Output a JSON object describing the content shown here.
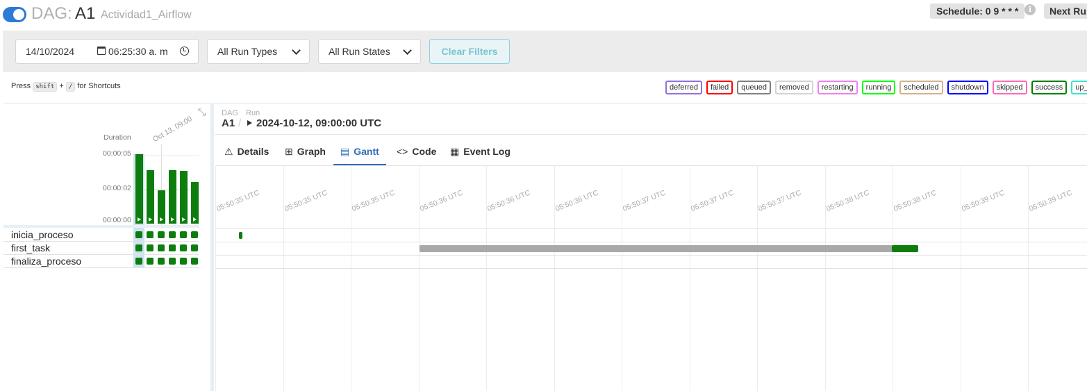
{
  "header": {
    "dag_prefix": "DAG:",
    "dag_id": "A1",
    "description": "Actividad1_Airflow",
    "schedule": "Schedule: 0 9 * * *",
    "info_icon_glyph": "i",
    "next_run": "Next Ru",
    "toggle_on": true
  },
  "filters": {
    "date": "14/10/2024",
    "time": "06:25:30 a. m",
    "run_types": "All Run Types",
    "run_states": "All Run States",
    "clear_label": "Clear Filters"
  },
  "shortcuts": {
    "press": "Press",
    "key1": "shift",
    "plus": "+",
    "key2": "/",
    "suffix": "for Shortcuts"
  },
  "legend": [
    {
      "label": "deferred",
      "color": "#9370db"
    },
    {
      "label": "failed",
      "color": "#ff0000"
    },
    {
      "label": "queued",
      "color": "#808080"
    },
    {
      "label": "removed",
      "color": "#d3d3d3"
    },
    {
      "label": "restarting",
      "color": "#ee82ee"
    },
    {
      "label": "running",
      "color": "#00ff00"
    },
    {
      "label": "scheduled",
      "color": "#d2b48c"
    },
    {
      "label": "shutdown",
      "color": "#0000ff"
    },
    {
      "label": "skipped",
      "color": "#ff69b4"
    },
    {
      "label": "success",
      "color": "#008000"
    },
    {
      "label": "up_for_",
      "color": "#40e0d0"
    }
  ],
  "grid": {
    "duration_label": "Duration",
    "ticks": [
      "00:00:05",
      "00:00:02",
      "00:00:00"
    ],
    "run_date_label": "Oct 13, 09:00",
    "run_durations": [
      1.0,
      0.77,
      0.48,
      0.77,
      0.76,
      0.6
    ],
    "tasks": [
      "inicia_proceso",
      "first_task",
      "finaliza_proceso"
    ],
    "collapse_icon": "⤡"
  },
  "breadcrumb": {
    "dag_label": "DAG",
    "run_label": "Run",
    "dag": "A1",
    "sep": "/",
    "run": "2024-10-12, 09:00:00 UTC"
  },
  "tabs": [
    {
      "icon": "⚠",
      "label": "Details"
    },
    {
      "icon": "⊞",
      "label": "Graph"
    },
    {
      "icon": "▤",
      "label": "Gantt"
    },
    {
      "icon": "<>",
      "label": "Code"
    },
    {
      "icon": "▦",
      "label": "Event Log"
    }
  ],
  "gantt": {
    "time_labels": [
      "05:50:35 UTC",
      "05:50:35 UTC",
      "05:50:35 UTC",
      "05:50:36 UTC",
      "05:50:36 UTC",
      "05:50:36 UTC",
      "05:50:37 UTC",
      "05:50:37 UTC",
      "05:50:37 UTC",
      "05:50:38 UTC",
      "05:50:38 UTC",
      "05:50:39 UTC",
      "05:50:39 UTC"
    ],
    "colors": {
      "queued": "#a9a9a9",
      "success": "#0d7e0d"
    }
  }
}
